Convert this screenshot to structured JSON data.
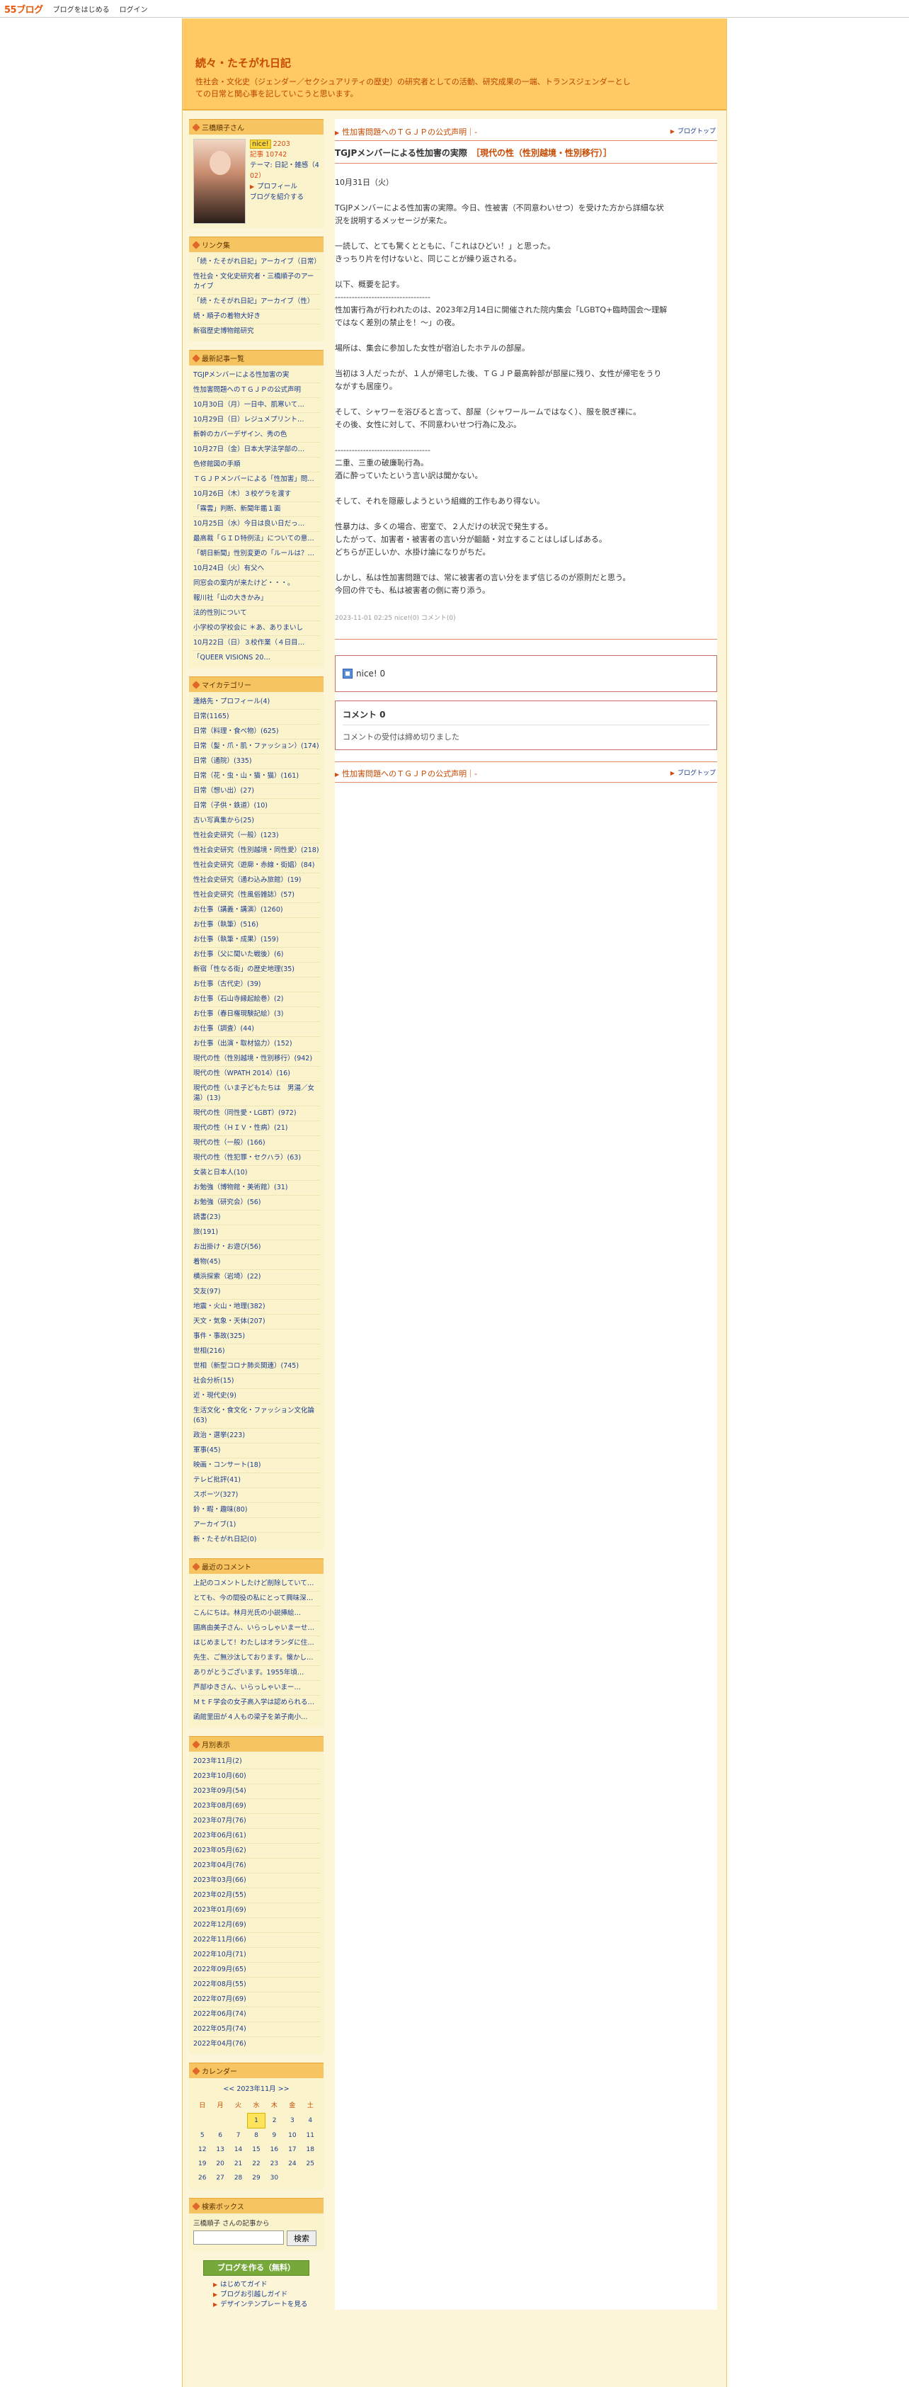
{
  "topbar": {
    "logo": "55ブログ",
    "start": "ブログをはじめる",
    "login": "ログイン"
  },
  "header": {
    "title": "続々・たそがれ日記",
    "desc_line1": "性社会・文化史（ジェンダー／セクシュアリティの歴史）の研究者としての活動、研究成果の一端、トランスジェンダーとし",
    "desc_line2": "ての日常と関心事を記していこうと思います。"
  },
  "profile": {
    "heading": "三橋順子さん",
    "nice_label": "nice!",
    "nice_count": "2203",
    "posts_label": "記事 10742",
    "theme": "テーマ: 日記・雑感（4",
    "theme2": "02）",
    "profile_link": "プロフィール",
    "introduce_link": "ブログを紹介する"
  },
  "links": {
    "heading": "リンク集",
    "items": [
      "「続・たそがれ日記」アーカイブ（日常）",
      "性社会・文化史研究者・三橋順子のアーカイブ",
      "「続・たそがれ日記」アーカイブ（性）",
      "続・順子の着物大好き",
      "新宿歴史博物館研究"
    ]
  },
  "recent": {
    "heading": "最新記事一覧",
    "items": [
      "TGJPメンバーによる性加害の実",
      "性加害問題へのＴＧＪＰの公式声明",
      "10月30日（月）一日中、肌寒いて…",
      "10月29日（日）レジュメプリント…",
      "新幹のカバーデザイン、秀の色",
      "10月27日（金）日本大学法学部の…",
      "色修館図の手順",
      "ＴＧＪＰメンバーによる「性加害」問…",
      "10月26日（木）３校ゲラを渡す",
      "「霧雲」判断、新聞年鑑１面",
      "10月25日（水）今日は良い日だっ…",
      "最高裁「ＧＩＤ特例法」についての意…",
      "「朝日新聞」性別変更の「ルールは？…",
      "10月24日（火）有父へ",
      "同窓会の案内が来たけど・・・。",
      "報川社「山の大きかみ」",
      "法的性別について",
      "小学校の学校会に ＊あ、ありまいし",
      "10月22日（日）３校作業（４日目…",
      "「QUEER VISIONS 20…"
    ]
  },
  "categories": {
    "heading": "マイカテゴリー",
    "items": [
      "連絡先・プロフィール(4)",
      "日常(1165)",
      "日常（料理・食べ物）(625)",
      "日常（髪・爪・肌・ファッション）(174)",
      "日常（通院）(335)",
      "日常（花・虫・山・猫・猫）(161)",
      "日常（想い出）(27)",
      "日常（子供・鉄道）(10)",
      "古い写真集から(25)",
      "性社会史研究（一般）(123)",
      "性社会史研究（性別越境・同性愛）(218)",
      "性社会史研究（遊廓・赤線・街娼）(84)",
      "性社会史研究（通わ込み旅館）(19)",
      "性社会史研究（性風俗雑誌）(57)",
      "お仕事（講義・講演）(1260)",
      "お仕事（執筆）(516)",
      "お仕事（執筆・成果）(159)",
      "お仕事（父に聞いた戦後）(6)",
      "新宿「性なる街」の歴史地理(35)",
      "お仕事（古代史）(39)",
      "お仕事（石山寺縁起絵巻）(2)",
      "お仕事（春日権現験記絵）(3)",
      "お仕事（調査）(44)",
      "お仕事（出演・取材協力）(152)",
      "現代の性（性別越境・性別移行）(942)",
      "現代の性（WPATH 2014）(16)",
      "現代の性（いま子どもたちは　男湯／女湯）(13)",
      "現代の性（同性愛・LGBT）(972)",
      "現代の性（ＨＩＶ・性病）(21)",
      "現代の性（一般）(166)",
      "現代の性（性犯罪・セクハラ）(63)",
      "女装と日本人(10)",
      "お勉強（博物館・美術館）(31)",
      "お勉強（研究会）(56)",
      "読書(23)",
      "旅(191)",
      "お出掛け・お遊び(56)",
      "着物(45)",
      "横浜探索（岩埼）(22)",
      "交友(97)",
      "地震・火山・地理(382)",
      "天文・気象・天体(207)",
      "事件・事故(325)",
      "世相(216)",
      "世相（新型コロナ肺炎関連）(745)",
      "社会分析(15)",
      "近・現代史(9)",
      "生活文化・食文化・ファッション文化論(63)",
      "政治・選挙(223)",
      "軍事(45)",
      "映画・コンサート(18)",
      "テレビ批評(41)",
      "スポーツ(327)",
      "鈴・暇・趣味(80)",
      "アーカイブ(1)",
      "新・たそがれ日記(0)"
    ]
  },
  "comments": {
    "heading": "最近のコメント",
    "items": [
      "上記のコメントしたけど削除していて…",
      "とても、今の間役の私にとって興味深…",
      "こんにちは。林月光氏の小説挿絵…",
      "國高由美子さん、いらっしゃいまーせ…",
      "はじめまして！わたしはオランダに住…",
      "先生、ご無沙汰しております。懐かし…",
      "ありがとうございます。1955年頃…",
      "芦部ゆきさん、いらっしゃいまー…",
      "ＭｔＦ学会の女子高入学は認められる…",
      "函館里田が４人もの梁子を弟子南小…"
    ]
  },
  "archive": {
    "heading": "月別表示",
    "items": [
      "2023年11月(2)",
      "2023年10月(60)",
      "2023年09月(54)",
      "2023年08月(69)",
      "2023年07月(76)",
      "2023年06月(61)",
      "2023年05月(62)",
      "2023年04月(76)",
      "2023年03月(66)",
      "2023年02月(55)",
      "2023年01月(69)",
      "2022年12月(69)",
      "2022年11月(66)",
      "2022年10月(71)",
      "2022年09月(65)",
      "2022年08月(55)",
      "2022年07月(69)",
      "2022年06月(74)",
      "2022年05月(74)",
      "2022年04月(76)"
    ]
  },
  "calendar": {
    "heading": "カレンダー",
    "nav": "<< 2023年11月 >>",
    "weekdays": [
      "日",
      "月",
      "火",
      "水",
      "木",
      "金",
      "土"
    ],
    "weeks": [
      [
        "",
        "",
        "",
        "1",
        "2",
        "3",
        "4"
      ],
      [
        "5",
        "6",
        "7",
        "8",
        "9",
        "10",
        "11"
      ],
      [
        "12",
        "13",
        "14",
        "15",
        "16",
        "17",
        "18"
      ],
      [
        "19",
        "20",
        "21",
        "22",
        "23",
        "24",
        "25"
      ],
      [
        "26",
        "27",
        "28",
        "29",
        "30",
        "",
        ""
      ]
    ],
    "today": "1"
  },
  "search": {
    "heading": "検索ボックス",
    "label": "三橋順子 さんの記事から",
    "button": "検索",
    "value": ""
  },
  "create": {
    "button": "ブログを作る（無料）",
    "guide1": "はじめてガイド",
    "guide2": "ブログお引越しガイド",
    "guide3": "デザインテンプレートを見る"
  },
  "entry": {
    "prev": "性加害問題へのＴＧＪＰの公式声明｜-",
    "top": "ブログトップ",
    "title": "TGJPメンバーによる性加害の実際",
    "category": "［現代の性（性別越境・性別移行）］",
    "paragraphs": [
      [
        "10月31日（火）"
      ],
      [
        "TGJPメンバーによる性加害の実際。今日、性被害（不同意わいせつ）を受けた方から詳細な状",
        "況を説明するメッセージが来た。"
      ],
      [
        "一読して、とても驚くとともに、「これはひどい！」と思った。",
        "きっちり片を付けないと、同じことが繰り返される。"
      ],
      [
        "以下、概要を記す。",
        "----------------------------------",
        "性加害行為が行われたのは、2023年2月14日に開催された院内集会「LGBTQ+臨時国会〜理解",
        "ではなく差別の禁止を！〜」の夜。"
      ],
      [
        "場所は、集会に参加した女性が宿泊したホテルの部屋。"
      ],
      [
        "当初は３人だったが、１人が帰宅した後、ＴＧＪＰ最高幹部が部屋に残り、女性が帰宅をうり",
        "ながすも居座り。"
      ],
      [
        "そして、シャワーを浴びると言って、部屋（シャワールームではなく）、服を脱ぎ裸に。",
        "その後、女性に対して、不同意わいせつ行為に及ぶ。"
      ],
      [
        "----------------------------------",
        "二重、三重の破廉恥行為。",
        "酒に酔っていたという言い訳は聞かない。"
      ],
      [
        "そして、それを隠蔽しようという組織的工作もあり得ない。"
      ],
      [
        "性暴力は、多くの場合、密室で、２人だけの状況で発生する。",
        "したがって、加害者・被害者の言い分が齟齬・対立することはしばしばある。",
        "どちらが正しいか、水掛け論になりがちだ。"
      ],
      [
        "しかし、私は性加害問題では、常に被害者の言い分をまず信じるのが原則だと思う。",
        "今回の件でも、私は被害者の側に寄り添う。"
      ]
    ],
    "footer": "2023-11-01 02:25  nice!(0)  コメント(0)",
    "nice_label": "nice! 0",
    "comment_heading": "コメント 0",
    "comment_closed": "コメントの受付は締め切りました",
    "bottom_prev": "性加害問題へのＴＧＪＰの公式声明｜-",
    "bottom_top": "ブログトップ"
  }
}
